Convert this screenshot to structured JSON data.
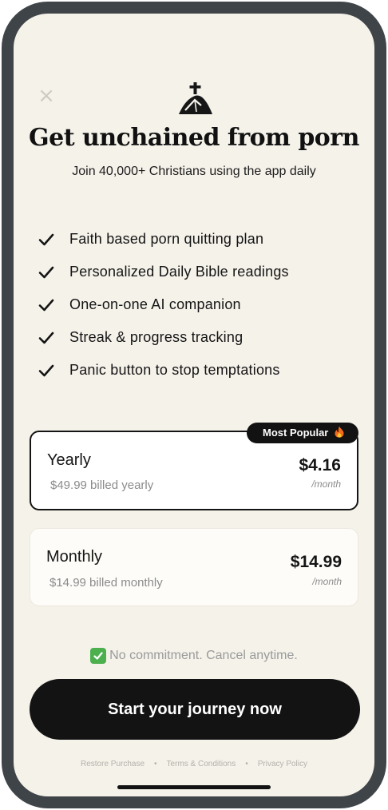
{
  "header": {
    "close_icon": "close-icon",
    "logo_icon": "cross-on-hill-icon",
    "title": "Get unchained from porn",
    "subtitle": "Join 40,000+ Christians using the app daily"
  },
  "features": [
    {
      "icon": "checkmark-icon",
      "label": "Faith based porn quitting plan"
    },
    {
      "icon": "checkmark-icon",
      "label": "Personalized Daily Bible readings"
    },
    {
      "icon": "checkmark-icon",
      "label": "One-on-one AI companion"
    },
    {
      "icon": "checkmark-icon",
      "label": "Streak & progress tracking"
    },
    {
      "icon": "checkmark-icon",
      "label": "Panic button to stop temptations"
    }
  ],
  "plans": {
    "yearly": {
      "name": "Yearly",
      "billing": "$49.99 billed yearly",
      "price": "$4.16",
      "unit": "/month",
      "badge": "Most Popular",
      "badge_icon": "fire-icon",
      "selected": true
    },
    "monthly": {
      "name": "Monthly",
      "billing": "$14.99 billed monthly",
      "price": "$14.99",
      "unit": "/month",
      "selected": false
    }
  },
  "commitment": {
    "icon": "green-checkbox-icon",
    "text": "No commitment. Cancel anytime."
  },
  "cta": {
    "label": "Start your journey now"
  },
  "footer": {
    "restore": "Restore Purchase",
    "terms": "Terms & Conditions",
    "privacy": "Privacy Policy",
    "separator": "•"
  },
  "colors": {
    "background": "#f5f2ea",
    "frame": "#3f4448",
    "primary": "#131313",
    "muted_text": "#8b8b8b",
    "success": "#4cb04f",
    "badge_fire": "#f26a1b"
  }
}
